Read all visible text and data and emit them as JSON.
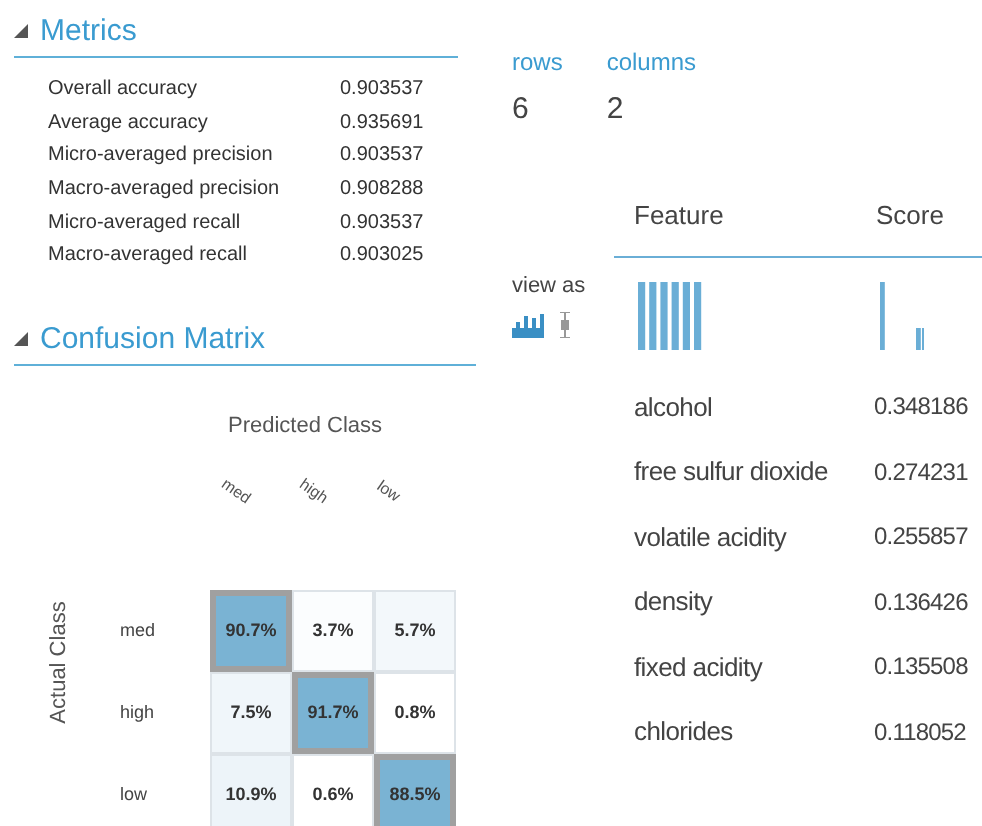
{
  "metrics": {
    "title": "Metrics",
    "expanded": true,
    "rows": [
      {
        "label": "Overall accuracy",
        "value": "0.903537"
      },
      {
        "label": "Average accuracy",
        "value": "0.935691"
      },
      {
        "label": "Micro-averaged precision",
        "value": "0.903537"
      },
      {
        "label": "Macro-averaged precision",
        "value": "0.908288"
      },
      {
        "label": "Micro-averaged recall",
        "value": "0.903537"
      },
      {
        "label": "Macro-averaged recall",
        "value": "0.903025"
      }
    ]
  },
  "confusion_matrix": {
    "title": "Confusion Matrix",
    "expanded": true,
    "x_title": "Predicted Class",
    "y_title": "Actual Class",
    "columns": [
      "med",
      "high",
      "low"
    ],
    "rows": [
      {
        "label": "med",
        "cells": [
          {
            "text": "90.7%",
            "color": "#7ab3d3",
            "highlighted": true
          },
          {
            "text": "3.7%",
            "color": "#fbfdfe",
            "highlighted": false
          },
          {
            "text": "5.7%",
            "color": "#f3f8fb",
            "highlighted": false
          }
        ]
      },
      {
        "label": "high",
        "cells": [
          {
            "text": "7.5%",
            "color": "#f0f6fa",
            "highlighted": false
          },
          {
            "text": "91.7%",
            "color": "#7ab3d3",
            "highlighted": true
          },
          {
            "text": "0.8%",
            "color": "#ffffff",
            "highlighted": false
          }
        ]
      },
      {
        "label": "low",
        "cells": [
          {
            "text": "10.9%",
            "color": "#edf4f9",
            "highlighted": false
          },
          {
            "text": "0.6%",
            "color": "#ffffff",
            "highlighted": false
          },
          {
            "text": "88.5%",
            "color": "#7ab3d3",
            "highlighted": true
          }
        ]
      }
    ]
  },
  "dataset": {
    "rows_label": "rows",
    "rows_value": "6",
    "columns_label": "columns",
    "columns_value": "2",
    "view_as": "view as",
    "columns": [
      "Feature",
      "Score"
    ],
    "rows": [
      {
        "feature": "alcohol",
        "score": "0.348186"
      },
      {
        "feature": "free sulfur dioxide",
        "score": "0.274231"
      },
      {
        "feature": "volatile acidity",
        "score": "0.255857"
      },
      {
        "feature": "density",
        "score": "0.136426"
      },
      {
        "feature": "fixed acidity",
        "score": "0.135508"
      },
      {
        "feature": "chlorides",
        "score": "0.118052"
      }
    ]
  }
}
